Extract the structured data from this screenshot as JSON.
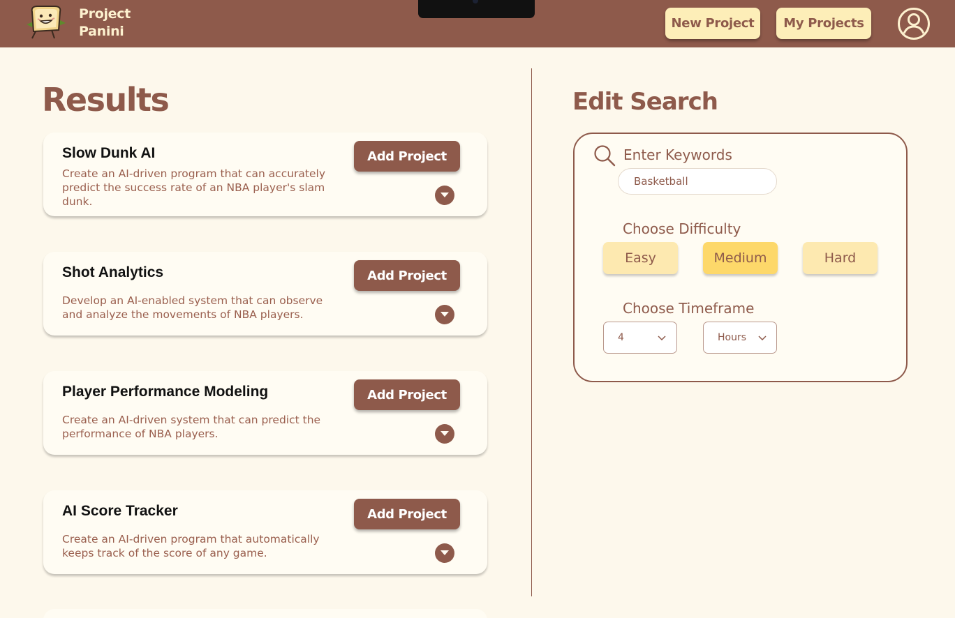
{
  "header": {
    "brand_line1": "Project",
    "brand_line2": "Panini",
    "new_project_label": "New Project",
    "my_projects_label": "My Projects",
    "icons": {
      "logo": "sandwich-logo-icon",
      "profile": "user-profile-icon"
    }
  },
  "results": {
    "title": "Results",
    "add_label": "Add Project",
    "items": [
      {
        "title": "Slow Dunk AI",
        "description": "Create an AI-driven program that can accurately predict the success rate of an NBA player's slam dunk."
      },
      {
        "title": "Shot Analytics",
        "description": "Develop an AI-enabled system that can observe and analyze the movements of NBA players."
      },
      {
        "title": "Player Performance Modeling",
        "description": "Create an AI-driven system that can predict the performance of NBA players."
      },
      {
        "title": "AI Score Tracker",
        "description": "Create an AI-driven program that automatically keeps track of the score of any game."
      }
    ]
  },
  "edit_search": {
    "title": "Edit Search",
    "keywords_label": "Enter Keywords",
    "keywords_value": "Basketball",
    "difficulty_label": "Choose Difficulty",
    "difficulty_options": [
      "Easy",
      "Medium",
      "Hard"
    ],
    "difficulty_selected": "Medium",
    "timeframe_label": "Choose Timeframe",
    "timeframe_amount": "4",
    "timeframe_unit": "Hours"
  },
  "colors": {
    "brand_brown": "#8e5a4b",
    "background": "#fdf8ec",
    "button_cream": "#fdeeb8",
    "selected_yellow": "#fdd86a"
  }
}
